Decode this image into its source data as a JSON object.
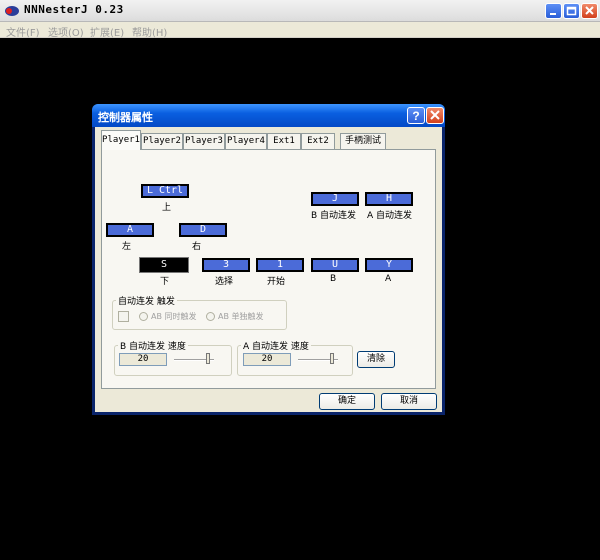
{
  "app": {
    "title": "NNNesterJ 0.23",
    "menu": [
      "文件(F)",
      "选项(O)",
      "扩展(E)",
      "帮助(H)"
    ]
  },
  "dialog": {
    "title": "控制器属性",
    "tabs": [
      "Player1",
      "Player2",
      "Player3",
      "Player4",
      "Ext1",
      "Ext2",
      "手柄测试"
    ],
    "active_tab": "Player1",
    "keys": {
      "up": {
        "key": "L Ctrl",
        "label": "上"
      },
      "left": {
        "key": "A",
        "label": "左"
      },
      "right": {
        "key": "D",
        "label": "右"
      },
      "down": {
        "key": "S",
        "label": "下"
      },
      "select": {
        "key": "3",
        "label": "选择"
      },
      "start": {
        "key": "1",
        "label": "开始"
      },
      "b": {
        "key": "U",
        "label": "B"
      },
      "a": {
        "key": "Y",
        "label": "A"
      },
      "turbo_b": {
        "key": "J",
        "label": "B 自动连发"
      },
      "turbo_a": {
        "key": "H",
        "label": "A 自动连发"
      }
    },
    "auto_fire_group": {
      "title": "自动连发 触发",
      "radio_simultaneous": "AB 同时触发",
      "radio_separate": "AB 单独触发"
    },
    "b_speed_group": {
      "title": "B 自动连发 速度",
      "value": "20",
      "level": 0.9
    },
    "a_speed_group": {
      "title": "A 自动连发 速度",
      "value": "20",
      "level": 0.9
    },
    "clear_button": "清除",
    "ok_button": "确定",
    "cancel_button": "取消"
  },
  "colors": {
    "key_blue": "#4b6bd8",
    "xp_title_blue": "#0349c6",
    "dialog_face": "#ece9d8"
  }
}
